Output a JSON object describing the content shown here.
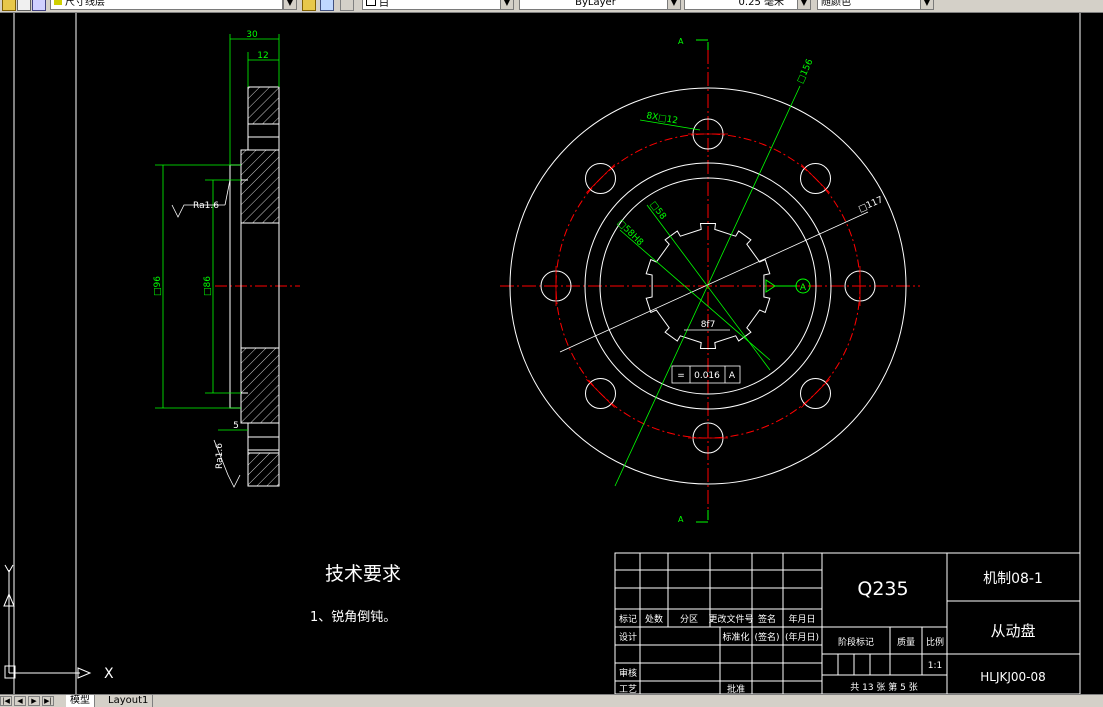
{
  "toolbar": {
    "layer_name": "尺寸线层",
    "textstyle": "白",
    "linetype": "ByLayer",
    "lineweight": "0.25 毫米",
    "plotstyle": "随颜色"
  },
  "tabs": [
    "模型",
    "Layout1"
  ],
  "drawing": {
    "section_dims": {
      "width_total": "30",
      "width_hub": "12",
      "gap": "5",
      "dia_outer": "□96",
      "dia_inner": "□86",
      "roughness_1": "Ra1.6",
      "roughness_2": "Ra1.6"
    },
    "front_view": {
      "section_mark": "A",
      "dim_outer": "□156",
      "dim_pcd": "□117",
      "dim_holes": "8X□12",
      "dim_spline_1": "□58",
      "dim_spline_2": "□58H8",
      "dim_width": "8f7",
      "tol_symbol": "=",
      "tol_value": "0.016",
      "tol_datum": "A",
      "datum_label": "A"
    },
    "tech_title": "技术要求",
    "tech_note": "1、锐角倒钝。"
  },
  "title_block": {
    "material": "Q235",
    "school": "机制08-1",
    "part_name": "从动盘",
    "drawing_no": "HLJKJ00-08",
    "headers": [
      "标记",
      "处数",
      "分区",
      "更改文件号",
      "签名",
      "年月日"
    ],
    "design": "设计",
    "standard": "标准化",
    "sign": "(签名)",
    "date": "(年月日)",
    "stage": "阶段标记",
    "weight": "质量",
    "ratio": "比例",
    "scale": "1:1",
    "review": "审核",
    "process": "工艺",
    "approve": "批准",
    "sheets": "共 13 张  第 5 张"
  },
  "ucs": {
    "x_label": "X",
    "y_label": "Y"
  }
}
